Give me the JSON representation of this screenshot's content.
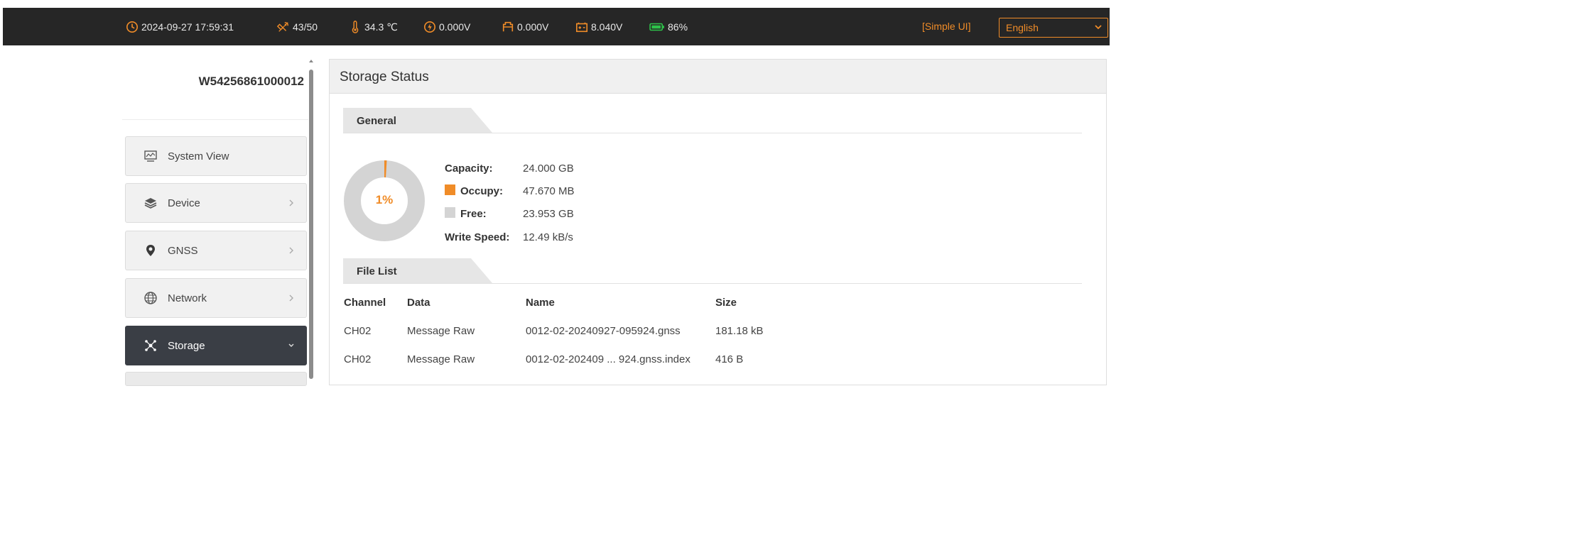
{
  "statusbar": {
    "datetime": "2024-09-27 17:59:31",
    "satellites": "43/50",
    "temperature": "34.3 ℃",
    "voltage1": "0.000V",
    "voltage2": "0.000V",
    "voltage3": "8.040V",
    "battery": "86%",
    "simple_ui": "[Simple UI]",
    "language": "English",
    "icon_color": "#f08c28",
    "battery_icon_color": "#2ec24a"
  },
  "sidebar": {
    "device_id": "W54256861000012",
    "items": [
      {
        "label": "System View",
        "icon": "monitor-icon"
      },
      {
        "label": "Device",
        "icon": "layers-icon"
      },
      {
        "label": "GNSS",
        "icon": "location-pin-icon"
      },
      {
        "label": "Network",
        "icon": "globe-icon"
      },
      {
        "label": "Storage",
        "icon": "storage-network-icon",
        "active": true
      }
    ]
  },
  "panel": {
    "title": "Storage Status",
    "general": {
      "heading": "General",
      "usage_percent_label": "1%",
      "usage_fraction": 0.01,
      "capacity_label": "Capacity:",
      "capacity_value": "24.000 GB",
      "occupy_label": "Occupy:",
      "occupy_value": "47.670 MB",
      "free_label": "Free:",
      "free_value": "23.953 GB",
      "write_speed_label": "Write Speed:",
      "write_speed_value": "12.49 kB/s",
      "occupy_color": "#f08c28",
      "free_color": "#d4d4d4"
    },
    "file_list": {
      "heading": "File List",
      "columns": [
        "Channel",
        "Data",
        "Name",
        "Size"
      ],
      "rows": [
        [
          "CH02",
          "Message Raw",
          "0012-02-20240927-095924.gnss",
          "181.18 kB"
        ],
        [
          "CH02",
          "Message Raw",
          "0012-02-202409 ... 924.gnss.index",
          "416 B"
        ]
      ]
    }
  }
}
